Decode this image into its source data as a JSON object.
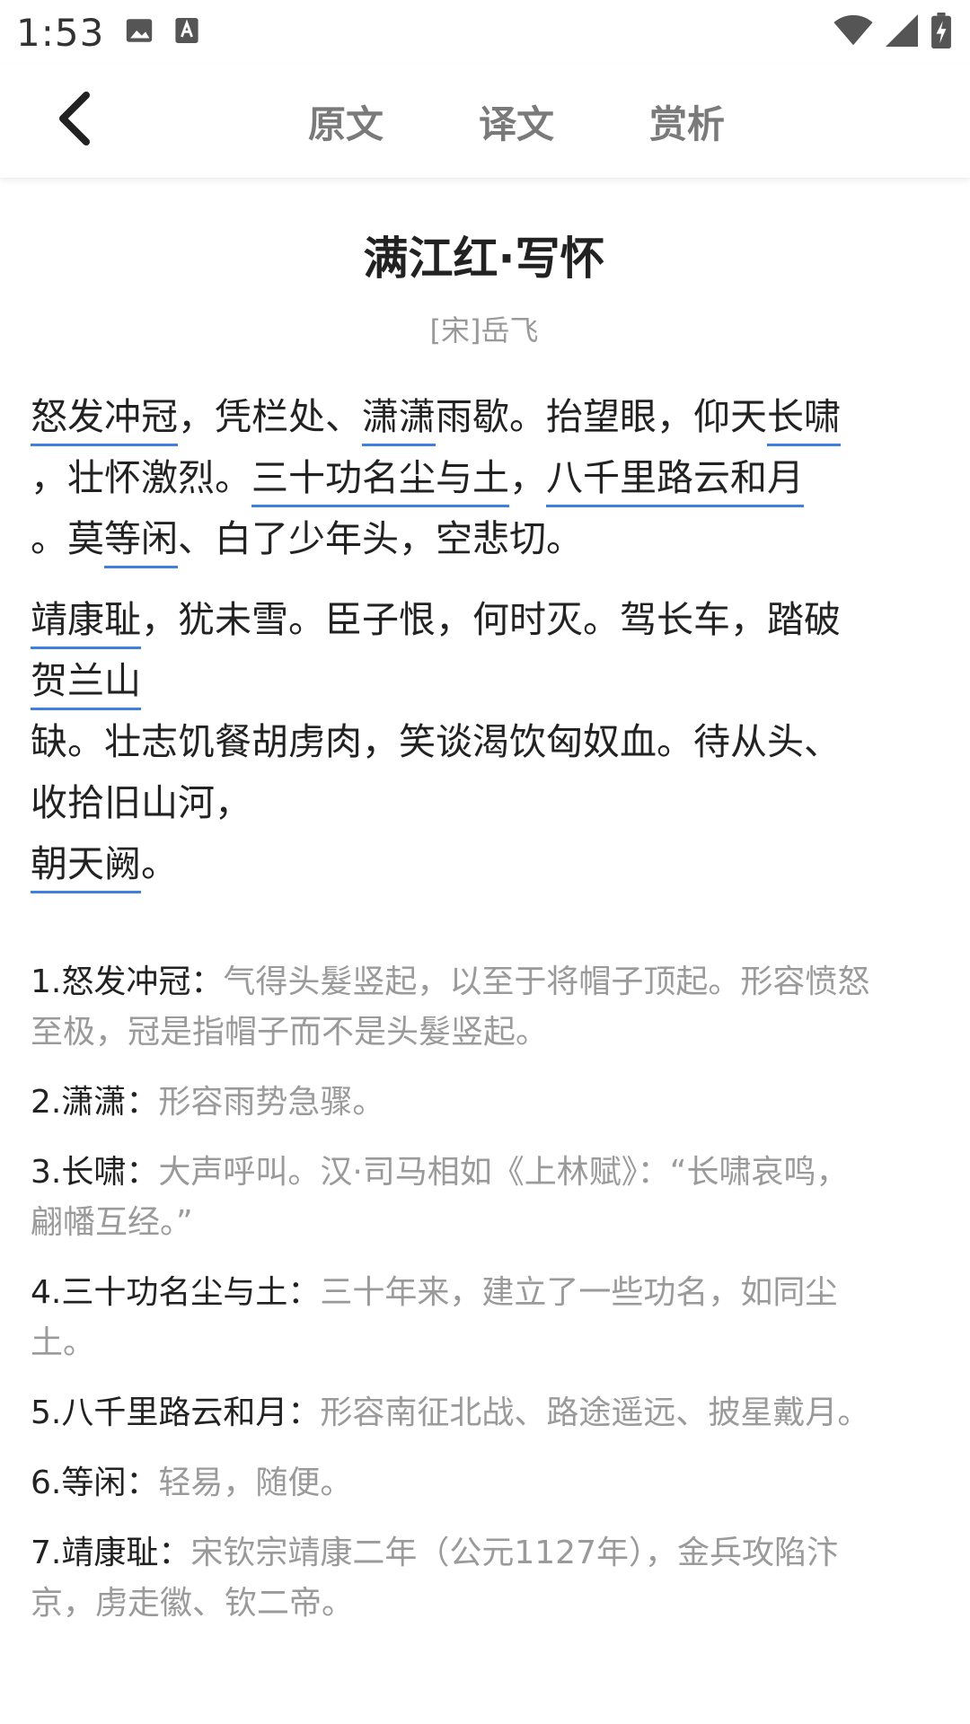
{
  "status_bar": {
    "time": "1:53"
  },
  "nav": {
    "tabs": [
      "原文",
      "译文",
      "赏析"
    ]
  },
  "poem": {
    "title": "满江红·写怀",
    "author": "[宋]岳飞",
    "stanza1": {
      "l1": [
        "怒发冲冠",
        "，凭栏处、",
        "潇潇",
        "雨歇。抬望眼，仰天",
        "长啸"
      ],
      "l2": [
        "，壮怀激烈。",
        "三十功名尘与土",
        "，",
        "八千里路云和月"
      ],
      "l3": [
        "。莫",
        "等闲",
        "、白了少年头，空悲切。"
      ]
    },
    "stanza2": {
      "l1": [
        "靖康耻",
        "，犹未雪。臣子恨，何时灭。驾长车，踏破"
      ],
      "l2": [
        "贺兰山"
      ],
      "l3": [
        "缺。壮志饥餐胡虏肉，笑谈渴饮匈奴血。待从头、"
      ],
      "l4": [
        "收拾旧山河，"
      ],
      "l5": [
        "朝天阙",
        "。"
      ]
    }
  },
  "notes": [
    {
      "term": "1.怒发冲冠：",
      "def1": "气得头髮竖起，以至于将帽子顶起。形容愤怒",
      "def2": "至极，冠是指帽子而不是头髮竖起。"
    },
    {
      "term": "2.潇潇：",
      "def1": "形容雨势急骤。",
      "def2": ""
    },
    {
      "term": "3.长啸：",
      "def1": "大声呼叫。汉·司马相如《上林赋》：“长啸哀鸣，",
      "def2": "翩幡互经。”"
    },
    {
      "term": "4.三十功名尘与土：",
      "def1": "三十年来，建立了一些功名，如同尘",
      "def2": "土。"
    },
    {
      "term": "5.八千里路云和月：",
      "def1": "形容南征北战、路途遥远、披星戴月。",
      "def2": ""
    },
    {
      "term": "6.等闲：",
      "def1": "轻易，随便。",
      "def2": ""
    },
    {
      "term": "7.靖康耻：",
      "def1": "宋钦宗靖康二年（公元1127年），金兵攻陷汴",
      "def2": "京，虏走徽、钦二帝。"
    }
  ],
  "colors": {
    "underline": "#3f7fe0",
    "definition": "#9a9a9a",
    "tab": "#7a7a7a"
  },
  "icons": [
    "image-icon",
    "text-a-icon",
    "wifi-icon",
    "signal-icon",
    "battery-charging-icon",
    "back-arrow-icon"
  ]
}
